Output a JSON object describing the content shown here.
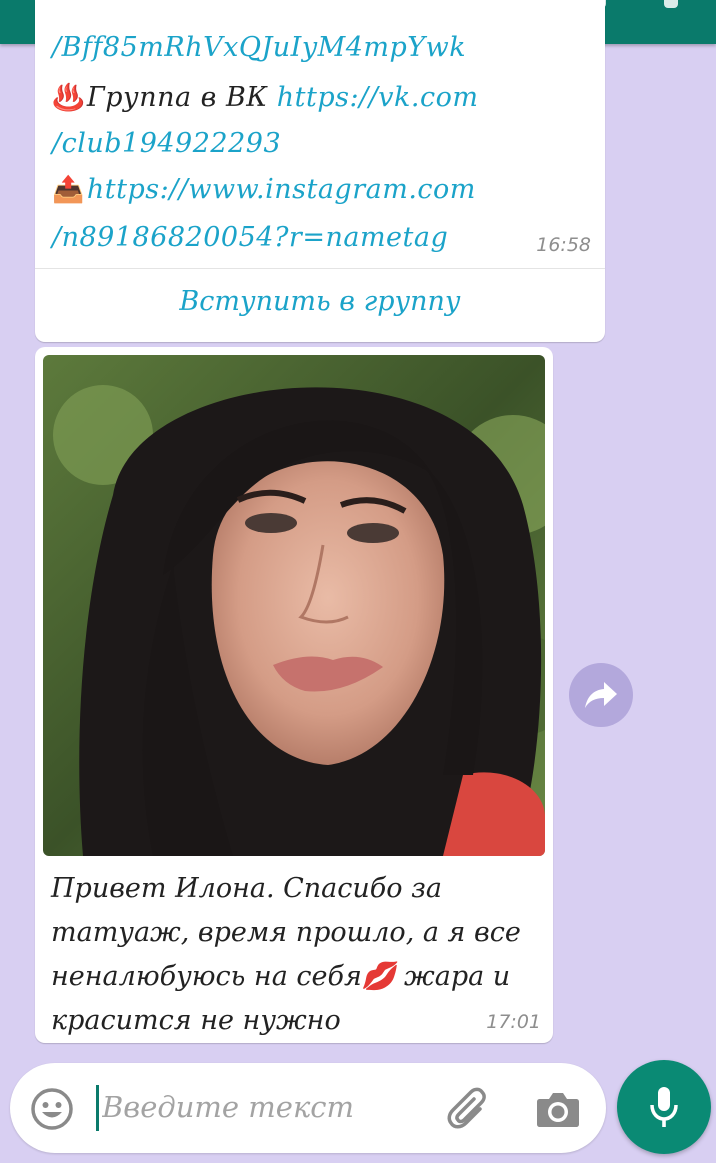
{
  "colors": {
    "header": "#0a7a6b",
    "background": "#d8cff2",
    "link": "#1ba3c9",
    "mic": "#0a8a74"
  },
  "header": {
    "avatar_icon": "contact-avatar"
  },
  "message1": {
    "line1": "/Bff85mRhVxQJuIyM4mpYwk",
    "line2_emoji": "♨️",
    "line2_text": "Группа в ВК ",
    "line2_link": "https://vk.com",
    "line3": "/club194922293",
    "line4_emoji": "📤",
    "line4_link": "https://www.instagram.com",
    "line5": "/n89186820054?r=nametag",
    "time": "16:58",
    "join_button": "Вступить в группу"
  },
  "message2": {
    "photo_icon": "photo",
    "caption_part1": "Привет Илона. Спасибо за татуаж, время прошло, а я все неналюбуюсь на себя",
    "caption_emoji": "💋",
    "caption_part2": " жара и красится не нужно",
    "time": "17:01"
  },
  "composer": {
    "placeholder": "Введите текст",
    "emoji_icon": "smiley-icon",
    "attach_icon": "paperclip-icon",
    "camera_icon": "camera-icon",
    "mic_icon": "mic-icon",
    "forward_icon": "forward-icon"
  }
}
